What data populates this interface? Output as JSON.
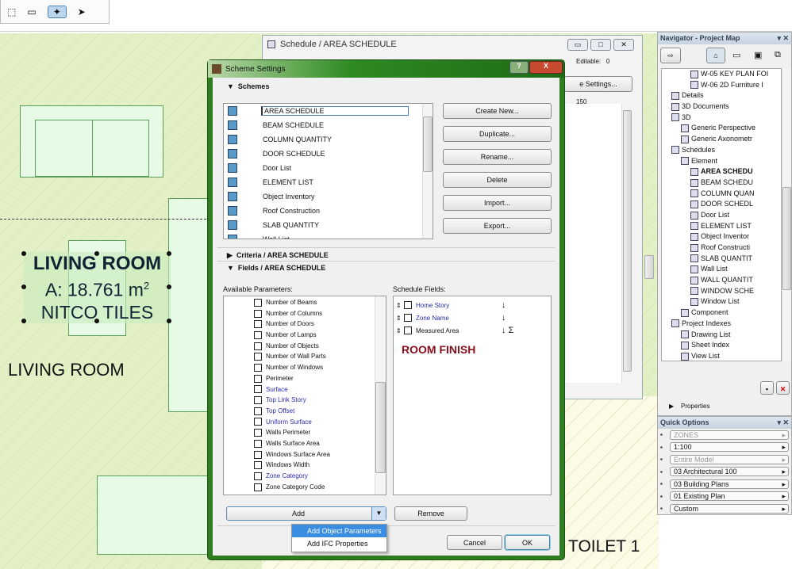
{
  "toolbar": {
    "tools": [
      {
        "icon": "marquee-icon"
      },
      {
        "icon": "rectangle-select-icon"
      },
      {
        "icon": "magic-wand-icon",
        "selected": true
      },
      {
        "icon": "arrow-pointer-icon"
      }
    ]
  },
  "plan": {
    "zone_name": "LIVING ROOM",
    "zone_area": "A: 18.761 m",
    "zone_area_sup": "2",
    "zone_finish": "NITCO  TILES",
    "room_text": "LIVING  ROOM",
    "toilet_text": "TOILET 1"
  },
  "schedule_window": {
    "title": "Schedule / AREA  SCHEDULE",
    "editable_label": "Editable:",
    "editable_value": "0",
    "settings_button": "e Settings...",
    "ruler_value": "150"
  },
  "dialog": {
    "title": "Scheme Settings",
    "help": "?",
    "close": "X",
    "schemes_header": "Schemes",
    "schemes": [
      "AREA  SCHEDULE",
      "BEAM  SCHEDULE",
      "COLUMN QUANTITY",
      "DOOR  SCHEDULE",
      "Door List",
      "ELEMENT LIST",
      "Object Inventory",
      "Roof Construction",
      "SLAB QUANTITY",
      "Wall List"
    ],
    "buttons": [
      "Create New...",
      "Duplicate...",
      "Rename...",
      "Delete",
      "Import...",
      "Export..."
    ],
    "criteria_header": "Criteria / AREA  SCHEDULE",
    "fields_header": "Fields / AREA  SCHEDULE",
    "available_label": "Available Parameters:",
    "schedule_fields_label": "Schedule Fields:",
    "parameters": [
      {
        "t": "Number of Beams"
      },
      {
        "t": "Number of Columns"
      },
      {
        "t": "Number of Doors"
      },
      {
        "t": "Number of Lamps"
      },
      {
        "t": "Number of Objects"
      },
      {
        "t": "Number of Wall Parts"
      },
      {
        "t": "Number of Windows"
      },
      {
        "t": "Perimeter"
      },
      {
        "t": "Surface",
        "blue": true
      },
      {
        "t": "Top Link Story",
        "blue": true
      },
      {
        "t": "Top Offset",
        "blue": true
      },
      {
        "t": "Uniform Surface",
        "blue": true
      },
      {
        "t": "Walls Perimeter"
      },
      {
        "t": "Walls Surface Area"
      },
      {
        "t": "Windows Surface Area"
      },
      {
        "t": "Windows Width"
      },
      {
        "t": "Zone Category",
        "blue": true
      },
      {
        "t": "Zone Category Code"
      }
    ],
    "fields": [
      {
        "t": "Home Story",
        "blue": true,
        "flags": "↓"
      },
      {
        "t": "Zone Name",
        "blue": true,
        "flags": "↓"
      },
      {
        "t": "Measured Area",
        "blue": false,
        "flags": "↓ Σ"
      }
    ],
    "annotation": "ROOM FINISH",
    "annotation_color": "#8b1020",
    "add": "Add",
    "remove": "Remove",
    "add_menu": [
      "Add Object Parameters",
      "Add IFC Properties"
    ],
    "cancel": "Cancel",
    "ok": "OK"
  },
  "navigator": {
    "title": "Navigator - Project Map",
    "tree": [
      {
        "t": "W-05 KEY PLAN FOI",
        "d": 3
      },
      {
        "t": "W-06 2D Furniture I",
        "d": 3
      },
      {
        "t": "Details",
        "d": 1
      },
      {
        "t": "3D Documents",
        "d": 1
      },
      {
        "t": "3D",
        "d": 1
      },
      {
        "t": "Generic Perspective",
        "d": 2
      },
      {
        "t": "Generic Axonometr",
        "d": 2
      },
      {
        "t": "Schedules",
        "d": 1
      },
      {
        "t": "Element",
        "d": 2
      },
      {
        "t": "AREA  SCHEDU",
        "d": 3,
        "bold": true
      },
      {
        "t": "BEAM  SCHEDU",
        "d": 3
      },
      {
        "t": "COLUMN QUAN",
        "d": 3
      },
      {
        "t": "DOOR  SCHEDL",
        "d": 3
      },
      {
        "t": "Door List",
        "d": 3
      },
      {
        "t": "ELEMENT LIST",
        "d": 3
      },
      {
        "t": "Object Inventor",
        "d": 3
      },
      {
        "t": "Roof Constructi",
        "d": 3
      },
      {
        "t": "SLAB QUANTIT",
        "d": 3
      },
      {
        "t": "Wall List",
        "d": 3
      },
      {
        "t": "WALL QUANTIT",
        "d": 3
      },
      {
        "t": "WINDOW  SCHE",
        "d": 3
      },
      {
        "t": "Window List",
        "d": 3
      },
      {
        "t": "Component",
        "d": 2
      },
      {
        "t": "Project Indexes",
        "d": 1
      },
      {
        "t": "Drawing List",
        "d": 2
      },
      {
        "t": "Sheet Index",
        "d": 2
      },
      {
        "t": "View List",
        "d": 2
      }
    ],
    "properties": "Properties"
  },
  "quick_options": {
    "title": "Quick Options",
    "rows": [
      {
        "t": "ZONES",
        "disabled": true
      },
      {
        "t": "1:100"
      },
      {
        "t": "Entire Model",
        "disabled": true
      },
      {
        "t": "03 Architectural 100"
      },
      {
        "t": "03 Building Plans"
      },
      {
        "t": "01 Existing Plan"
      },
      {
        "t": "Custom"
      }
    ]
  }
}
